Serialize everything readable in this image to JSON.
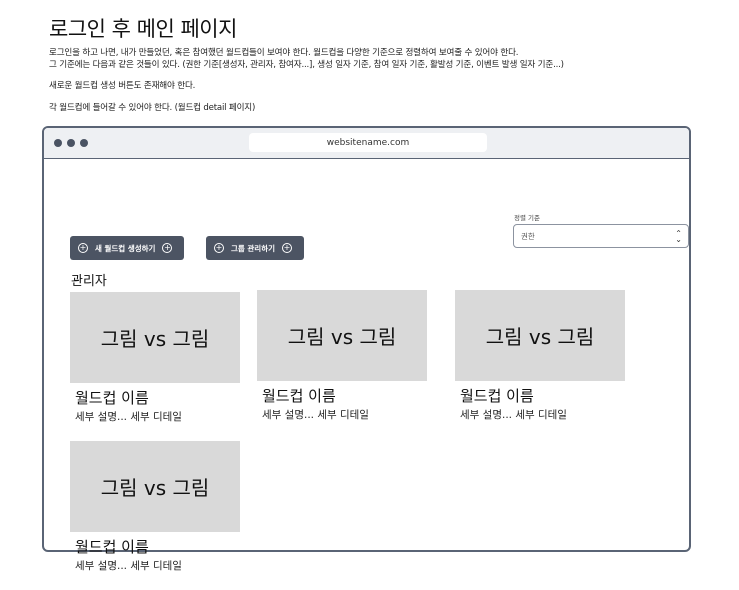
{
  "page": {
    "title": "로그인 후  메인 페이지",
    "desc_lines": [
      "로그인을 하고 나면,  내가 만들었던, 혹은 참여했던 월드컵들이 보여야 한다. 월드컵을 다양한 기준으로 정렬하여 보여줄 수 있어야 한다.",
      "그 기준에는 다음과 같은 것들이 있다. (권한 기준[생성자, 관리자, 참여자...], 생성 일자 기준, 참여 일자 기준, 활발성 기준, 이벤트 발생 일자 기준...)",
      "새로운 월드컵 생성 버튼도 존재해야 한다.",
      "각 월드컵에 들어갈 수 있어야 한다. (월드컵 detail 페이지)"
    ]
  },
  "browser": {
    "url": "websitename.com"
  },
  "sort": {
    "label": "정렬 기준",
    "value": "권한",
    "chevron_icon": "chevron-up-down-icon"
  },
  "buttons": {
    "create": {
      "label": "새 월드컵 생성하기",
      "icon": "plus-circle-icon"
    },
    "group": {
      "label": "그룹 관리하기",
      "icon": "plus-circle-icon"
    }
  },
  "section": {
    "title": "관리자"
  },
  "cards": [
    {
      "thumb": "그림 vs 그림",
      "name": "월드컵 이름",
      "desc": "세부 설명... 세부 디테일"
    },
    {
      "thumb": "그림 vs 그림",
      "name": "월드컵 이름",
      "desc": "세부 설명... 세부 디테일"
    },
    {
      "thumb": "그림 vs 그림",
      "name": "월드컵 이름",
      "desc": "세부 설명... 세부 디테일"
    },
    {
      "thumb": "그림 vs 그림",
      "name": "월드컵 이름",
      "desc": "세부 설명... 세부 디테일"
    }
  ],
  "colors": {
    "button_bg": "#4c5463",
    "frame_border": "#5a6475",
    "thumb_bg": "#d9d9d9"
  }
}
